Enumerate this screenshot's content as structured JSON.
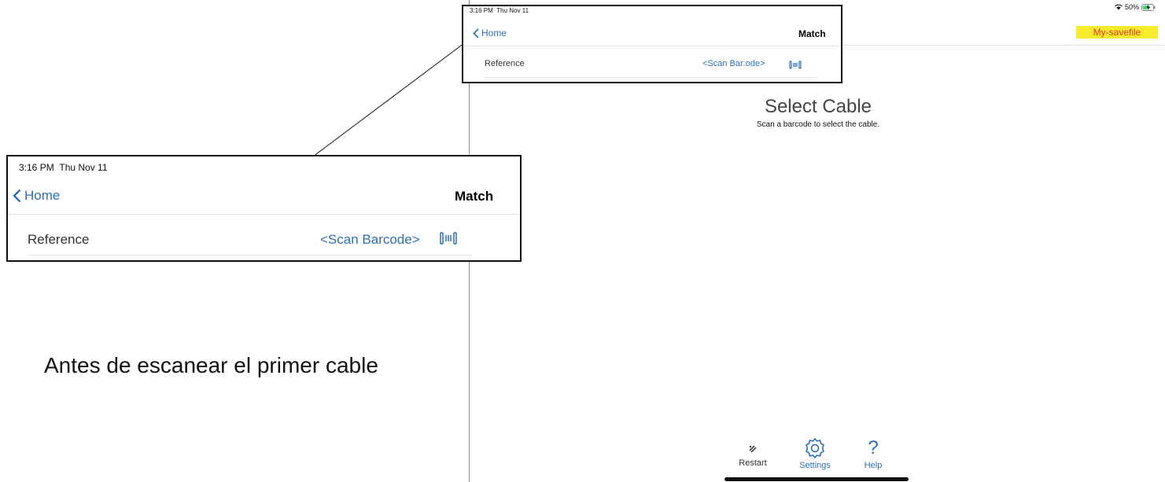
{
  "status": {
    "time": "3:16 PM",
    "date": "Thu Nov 11",
    "battery": "50%"
  },
  "nav": {
    "back_label": "Home",
    "title": "Match",
    "savefile": "My-savefile"
  },
  "form": {
    "reference_label": "Reference",
    "scan_prompt": "<Scan Barcode>",
    "scan_prompt_small": "<Scan Bar:ode>"
  },
  "main": {
    "title": "Select Cable",
    "subtitle": "Scan a barcode to select the cable."
  },
  "toolbar": {
    "restart": "Restart",
    "settings": "Settings",
    "help": "Help",
    "help_glyph": "?"
  },
  "caption": "Antes de escanear el primer cable",
  "colors": {
    "accent": "#2f6fb8",
    "savefile_bg": "#f7ec2b",
    "savefile_text": "#e53a2a"
  }
}
